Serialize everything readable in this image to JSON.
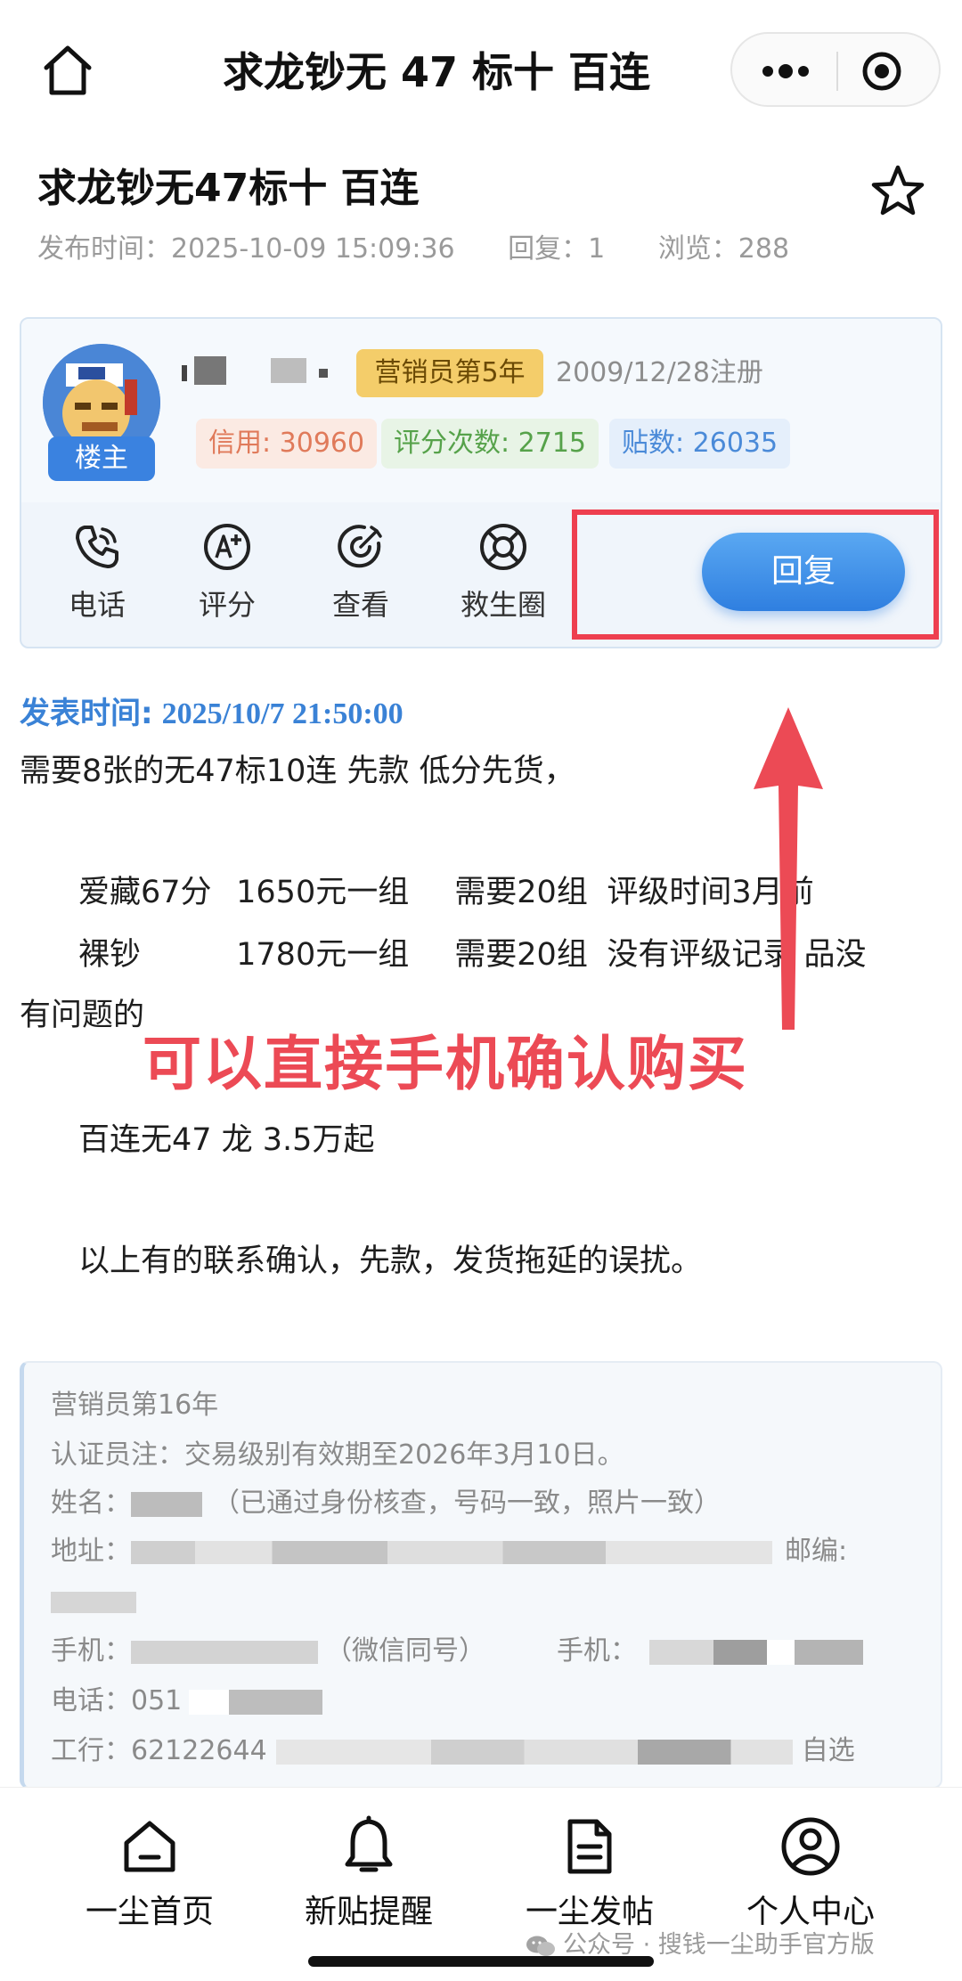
{
  "nav": {
    "title": "求龙钞无 47 标十 百连"
  },
  "post": {
    "title": "求龙钞无47标十 百连",
    "meta": {
      "published": "发布时间：2025-10-09 15:09:36",
      "replies": "回复：1",
      "views": "浏览：288"
    }
  },
  "author": {
    "badge": "楼主",
    "role": "营销员第5年",
    "registered": "2009/12/28注册",
    "credit": "信用: 30960",
    "rating_count": "评分次数: 2715",
    "post_count": "贴数: 26035",
    "actions": {
      "phone": "电话",
      "score": "评分",
      "view": "查看",
      "lifebuoy": "救生圈"
    },
    "reply": "回复"
  },
  "content": {
    "time_label": "发表时间:",
    "time_value": "2025/10/7 21:50:00",
    "line1": "需要8张的无47标10连 先款  低分先货，",
    "line2": {
      "a": "爱藏67分",
      "b": "1650元一组",
      "c": "需要20组",
      "d": "评级时间3月前"
    },
    "line3": {
      "a": "裸钞",
      "b": "1780元一组",
      "c": "需要20组",
      "d": "没有评级记录  品没"
    },
    "line4": "有问题的",
    "line5": "百连无47 龙   3.5万起",
    "line6": "以上有的联系确认，先款，发货拖延的误扰。"
  },
  "annotation": {
    "text": "可以直接手机确认购买",
    "color": "#ec4a55"
  },
  "certification": {
    "role": "营销员第16年",
    "note": "认证员注：交易级别有效期至2026年3月10日。",
    "name": "姓名：",
    "name_note": "（已通过身份核查，号码一致，照片一致）",
    "address": "地址：",
    "postcode_label": "邮编:",
    "mobile_label": "手机：",
    "mobile_note": "（微信同号）",
    "mobile_label2": "手机：",
    "phone_label": "电话：",
    "phone_prefix": "051",
    "bank_label": "工行：",
    "bank_prefix": "62122644",
    "bank_suffix": "自选"
  },
  "tabbar": {
    "home": "一尘首页",
    "remind": "新贴提醒",
    "post": "一尘发帖",
    "user": "个人中心"
  },
  "watermark": "公众号 · 搜钱一尘助手官方版",
  "colors": {
    "accent_blue": "#3a82d6",
    "highlight_red": "#ee3f4f",
    "role_badge": "#f4cd6a"
  }
}
